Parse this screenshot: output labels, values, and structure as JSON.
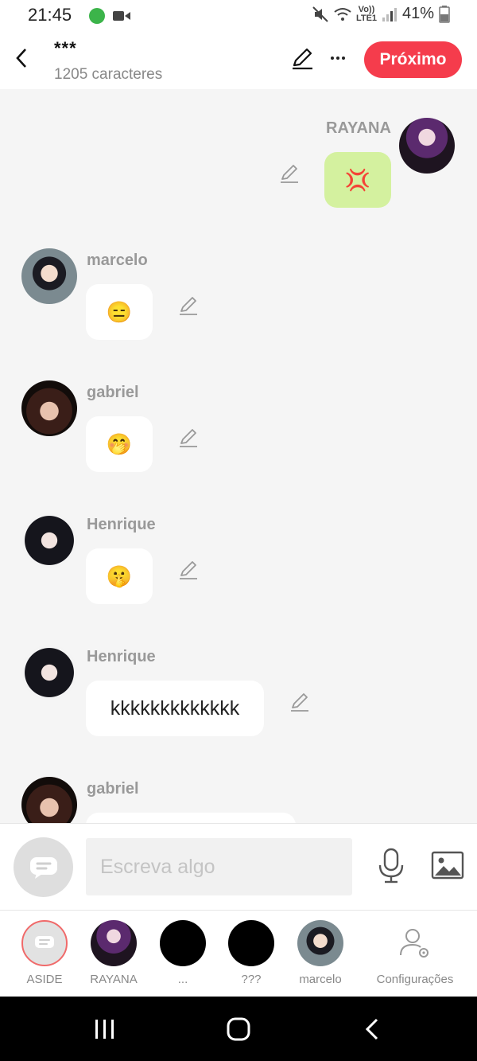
{
  "status": {
    "time": "21:45",
    "network": "Vo)) LTE1",
    "battery": "41%"
  },
  "header": {
    "title": "***",
    "subtitle": "1205 caracteres",
    "next_label": "Próximo"
  },
  "messages": [
    {
      "name": "RAYANA",
      "content": "💢",
      "mine": true
    },
    {
      "name": "marcelo",
      "content": "😑"
    },
    {
      "name": "gabriel",
      "content": "🤭"
    },
    {
      "name": "Henrique",
      "content": "🤫"
    },
    {
      "name": "Henrique",
      "content": "kkkkkkkkkkkkk"
    },
    {
      "name": "gabriel",
      "content": ""
    }
  ],
  "composer": {
    "placeholder": "Escreva algo"
  },
  "tabs": [
    {
      "label": "ASIDE"
    },
    {
      "label": "RAYANA"
    },
    {
      "label": "..."
    },
    {
      "label": "???"
    },
    {
      "label": "marcelo"
    },
    {
      "label": "Configurações"
    }
  ],
  "colors": {
    "accent": "#f53c4c",
    "mine_bubble": "#d4f19f",
    "background": "#f5f5f5"
  }
}
